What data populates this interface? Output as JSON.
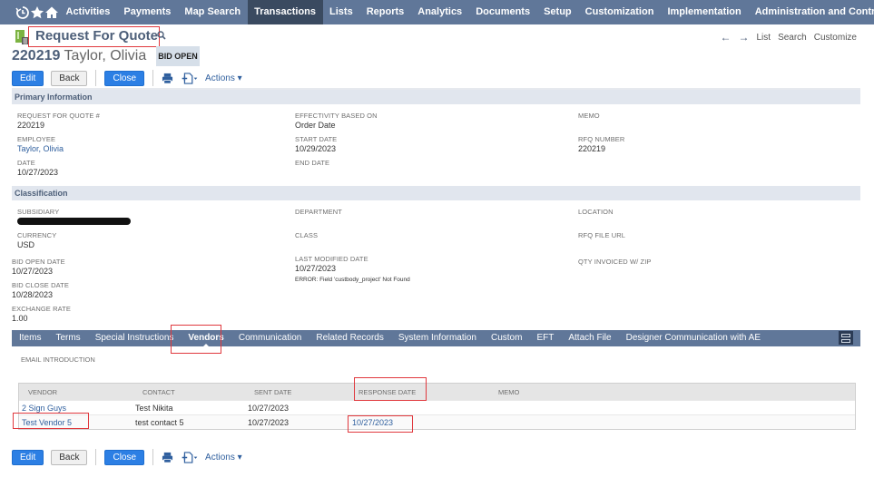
{
  "topnav": {
    "icons": [
      "recent-history-icon",
      "star-icon",
      "home-icon"
    ],
    "items": [
      "Activities",
      "Payments",
      "Map Search",
      "Transactions",
      "Lists",
      "Reports",
      "Analytics",
      "Documents",
      "Setup",
      "Customization",
      "Implementation",
      "Administration and Controls"
    ],
    "active": "Transactions",
    "more": "•••"
  },
  "header": {
    "title": "Request For Quote",
    "record_number": "220219",
    "record_name": "Taylor, Olivia",
    "status": "BID OPEN"
  },
  "right_nav": {
    "back_arrow": "←",
    "forward_arrow": "→",
    "list": "List",
    "search": "Search",
    "customize": "Customize"
  },
  "toolbar": {
    "edit": "Edit",
    "back": "Back",
    "close": "Close",
    "actions": "Actions ▾"
  },
  "primary": {
    "section_title": "Primary Information",
    "fields": {
      "rfq_num": {
        "label": "REQUEST FOR QUOTE #",
        "value": "220219"
      },
      "employee": {
        "label": "EMPLOYEE",
        "value": "Taylor, Olivia"
      },
      "date": {
        "label": "DATE",
        "value": "10/27/2023"
      },
      "effectivity": {
        "label": "EFFECTIVITY BASED ON",
        "value": "Order Date"
      },
      "start_date": {
        "label": "START DATE",
        "value": "10/29/2023"
      },
      "end_date": {
        "label": "END DATE",
        "value": ""
      },
      "memo": {
        "label": "MEMO",
        "value": ""
      },
      "rfq_number": {
        "label": "RFQ NUMBER",
        "value": "220219"
      }
    }
  },
  "classification": {
    "section_title": "Classification",
    "fields": {
      "subsidiary": {
        "label": "SUBSIDIARY",
        "value": "[redacted]"
      },
      "currency": {
        "label": "CURRENCY",
        "value": "USD"
      },
      "bid_open_date": {
        "label": "BID OPEN DATE",
        "value": "10/27/2023"
      },
      "bid_close_date": {
        "label": "BID CLOSE DATE",
        "value": "10/28/2023"
      },
      "exchange_rate": {
        "label": "EXCHANGE RATE",
        "value": "1.00"
      },
      "department": {
        "label": "DEPARTMENT",
        "value": ""
      },
      "class": {
        "label": "CLASS",
        "value": ""
      },
      "last_modified": {
        "label": "LAST MODIFIED DATE",
        "value": "10/27/2023",
        "error": "ERROR: Field 'custbody_project' Not Found"
      },
      "location": {
        "label": "LOCATION",
        "value": ""
      },
      "rfq_file_url": {
        "label": "RFQ FILE URL",
        "value": ""
      },
      "qty_invoiced": {
        "label": "QTY INVOICED W/ ZIP",
        "value": ""
      }
    }
  },
  "subtabs": {
    "items": [
      "Items",
      "Terms",
      "Special Instructions",
      "Vendors",
      "Communication",
      "Related Records",
      "System Information",
      "Custom",
      "EFT",
      "Attach File",
      "Designer Communication with AE"
    ],
    "active": "Vendors"
  },
  "vendors": {
    "email_intro_label": "EMAIL INTRODUCTION",
    "columns": [
      "VENDOR",
      "CONTACT",
      "SENT DATE",
      "RESPONSE DATE",
      "MEMO"
    ],
    "rows": [
      {
        "vendor": "2 Sign Guys",
        "contact": "Test Nikita",
        "sent_date": "10/27/2023",
        "response_date": "",
        "memo": ""
      },
      {
        "vendor": "Test Vendor 5",
        "contact": "test contact 5",
        "sent_date": "10/27/2023",
        "response_date": "10/27/2023",
        "memo": ""
      }
    ]
  },
  "colors": {
    "nav_bg": "#607799",
    "nav_active": "#3a4a60",
    "primary_button": "#2c7fe4",
    "link": "#2f5f9e",
    "section_bg": "#e1e6ee",
    "highlight": "#e0393e"
  }
}
